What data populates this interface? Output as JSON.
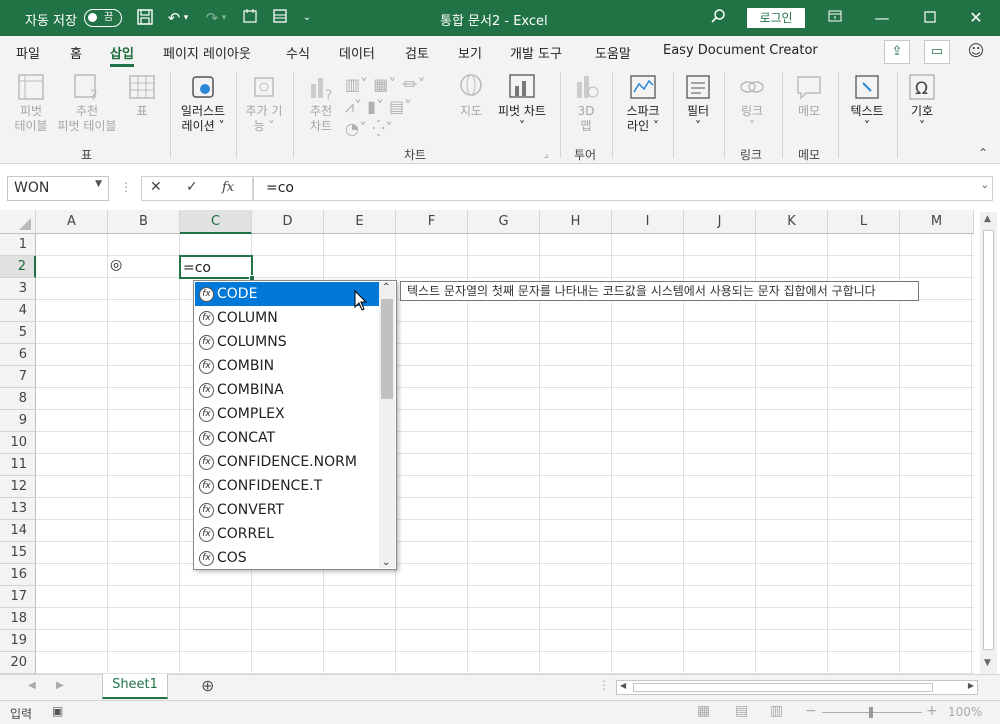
{
  "titlebar": {
    "autosave_label": "자동 저장",
    "autosave_state": "끔",
    "doc_title": "통합 문서2  -  Excel",
    "login_label": "로그인"
  },
  "menu": {
    "items": [
      "파일",
      "홈",
      "삽입",
      "페이지 레이아웃",
      "수식",
      "데이터",
      "검토",
      "보기",
      "개발 도구",
      "도움말",
      "Easy Document Creator"
    ],
    "active": "삽입"
  },
  "ribbon": {
    "pivot_table": [
      "피벗",
      "테이블"
    ],
    "rec_pivot": [
      "추천",
      "피벗 테이블"
    ],
    "table": "표",
    "illustrations": [
      "일러스트",
      "레이션 ˅"
    ],
    "addins": [
      "추가 기",
      "능 ˅"
    ],
    "rec_charts": [
      "추천",
      "차트"
    ],
    "maps": "지도",
    "pivot_chart": "피벗 차트",
    "map3d": [
      "3D",
      "맵"
    ],
    "sparkline": [
      "스파크",
      "라인 ˅"
    ],
    "filter": "필터",
    "link": "링크",
    "memo": "메모",
    "text": "텍스트",
    "symbol": "기호",
    "groups": {
      "table": "표",
      "charts": "차트",
      "tour": "투어",
      "links": "링크",
      "comments": "메모"
    }
  },
  "formula_bar": {
    "name_box": "WON",
    "formula": "=co"
  },
  "grid": {
    "columns": [
      "A",
      "B",
      "C",
      "D",
      "E",
      "F",
      "G",
      "H",
      "I",
      "J",
      "K",
      "L",
      "M"
    ],
    "rows": [
      "1",
      "2",
      "3",
      "4",
      "5",
      "6",
      "7",
      "8",
      "9",
      "10",
      "11",
      "12",
      "13",
      "14",
      "15",
      "16",
      "17",
      "18",
      "19",
      "20"
    ],
    "selected_col": "C",
    "selected_row": "2",
    "b2_value": "◎",
    "c2_value": "=co"
  },
  "autocomplete": {
    "items": [
      "CODE",
      "COLUMN",
      "COLUMNS",
      "COMBIN",
      "COMBINA",
      "COMPLEX",
      "CONCAT",
      "CONFIDENCE.NORM",
      "CONFIDENCE.T",
      "CONVERT",
      "CORREL",
      "COS"
    ],
    "selected": "CODE",
    "tooltip": "텍스트 문자열의 첫째 문자를 나타내는 코드값을 시스템에서 사용되는 문자 집합에서 구합니다"
  },
  "sheets": {
    "tabs": [
      "Sheet1"
    ]
  },
  "status": {
    "mode": "입력",
    "zoom": "100%"
  },
  "colors": {
    "accent": "#217346",
    "selection": "#0078d7"
  }
}
